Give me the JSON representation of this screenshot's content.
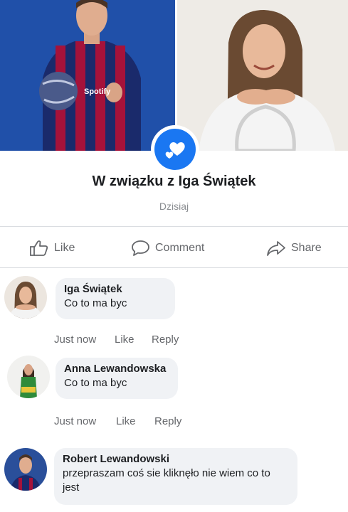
{
  "post": {
    "event_title": "W związku z  Iga Świątek",
    "event_date": "Dzisiaj",
    "life_event_icon": "hearts-icon",
    "accent_color": "#1a77f2"
  },
  "actions": {
    "like_label": "Like",
    "comment_label": "Comment",
    "share_label": "Share"
  },
  "comments": [
    {
      "author": "Iga Świątek",
      "text": "Co to ma byc",
      "time": "Just now",
      "like_label": "Like",
      "reply_label": "Reply"
    },
    {
      "author": "Anna Lewandowska",
      "text": "Co to ma byc",
      "time": "Just now",
      "like_label": "Like",
      "reply_label": "Reply"
    },
    {
      "author": "Robert Lewandowski",
      "text": "przepraszam coś sie kliknęło nie wiem co to jest"
    }
  ]
}
